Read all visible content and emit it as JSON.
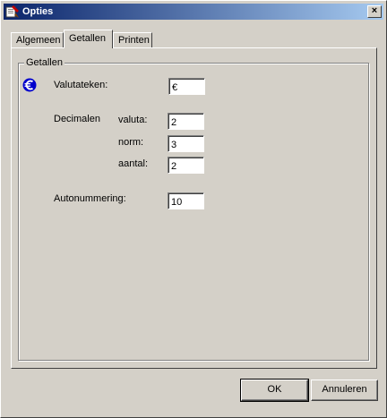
{
  "window": {
    "title": "Opties",
    "close_label": "×"
  },
  "tabs": [
    {
      "label": "Algemeen",
      "active": false
    },
    {
      "label": "Getallen",
      "active": true
    },
    {
      "label": "Printen",
      "active": false
    }
  ],
  "group": {
    "title": "Getallen",
    "currency": {
      "label": "Valutateken:",
      "value": "€"
    },
    "decimals": {
      "label": "Decimalen",
      "fields": [
        {
          "label": "valuta:",
          "value": "2"
        },
        {
          "label": "norm:",
          "value": "3"
        },
        {
          "label": "aantal:",
          "value": "2"
        }
      ]
    },
    "autonumbering": {
      "label": "Autonummering:",
      "value": "10"
    }
  },
  "buttons": {
    "ok": "OK",
    "cancel": "Annuleren"
  },
  "colors": {
    "titlebar_start": "#0a246a",
    "titlebar_end": "#a6caf0",
    "euro_icon": "#0000cc",
    "face": "#d4d0c8"
  },
  "icons": {
    "app": "app-icon",
    "close": "close-icon",
    "currency": "euro-icon"
  }
}
